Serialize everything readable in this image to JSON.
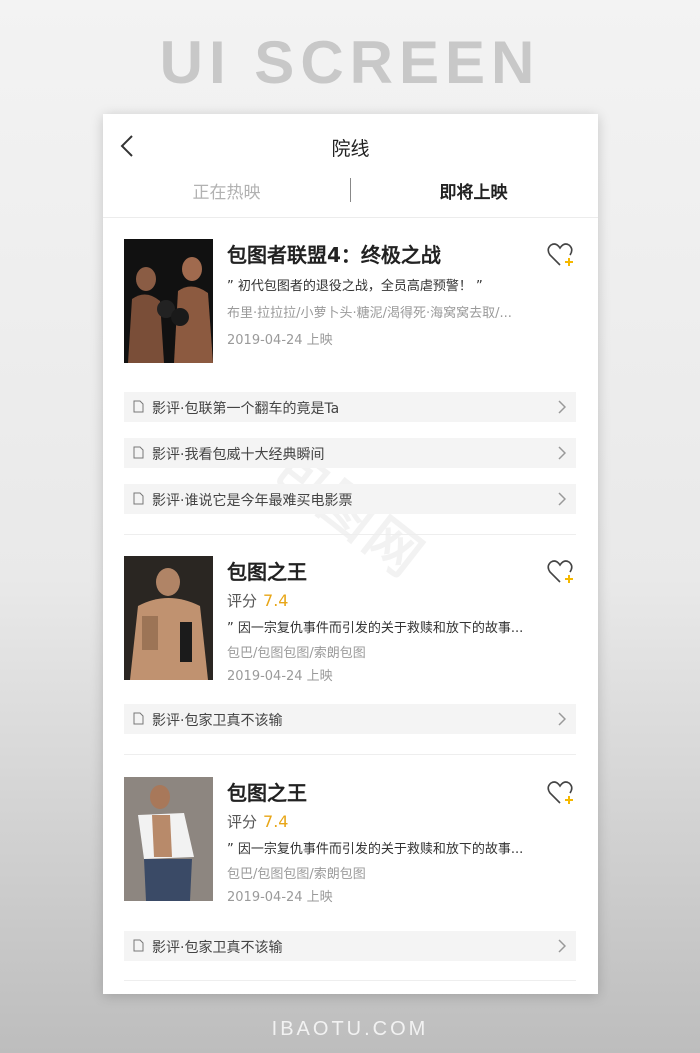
{
  "hero": {
    "title": "UI SCREEN"
  },
  "footer": {
    "brand": "IBAOTU.COM"
  },
  "nav": {
    "title": "院线"
  },
  "tabs": {
    "left": "正在热映",
    "right": "即将上映"
  },
  "watermark": "包图网",
  "movies": [
    {
      "title": "包图者联盟4：终极之战",
      "quote": "” 初代包图者的退役之战，全员高虐预警！ ”",
      "cast": "布里·拉拉拉/小萝卜头·糖泥/渴得死·海窝窝去取/...",
      "date": "2019-04-24 上映",
      "reviews": [
        "影评·包联第一个翻车的竟是Ta",
        "影评·我看包威十大经典瞬间",
        "影评·谁说它是今年最难买电影票"
      ]
    },
    {
      "title": "包图之王",
      "score_label": "评分",
      "score": "7.4",
      "quote": "” 因一宗复仇事件而引发的关于救赎和放下的故事...",
      "cast": "包巴/包图包图/索朗包图",
      "date": "2019-04-24 上映",
      "reviews": [
        "影评·包家卫真不该输"
      ]
    },
    {
      "title": "包图之王",
      "score_label": "评分",
      "score": "7.4",
      "quote": "” 因一宗复仇事件而引发的关于救赎和放下的故事...",
      "cast": "包巴/包图包图/索朗包图",
      "date": "2019-04-24 上映",
      "reviews": [
        "影评·包家卫真不该输"
      ]
    }
  ],
  "colors": {
    "accent": "#e8a617",
    "heart_plus": "#f5b800"
  }
}
